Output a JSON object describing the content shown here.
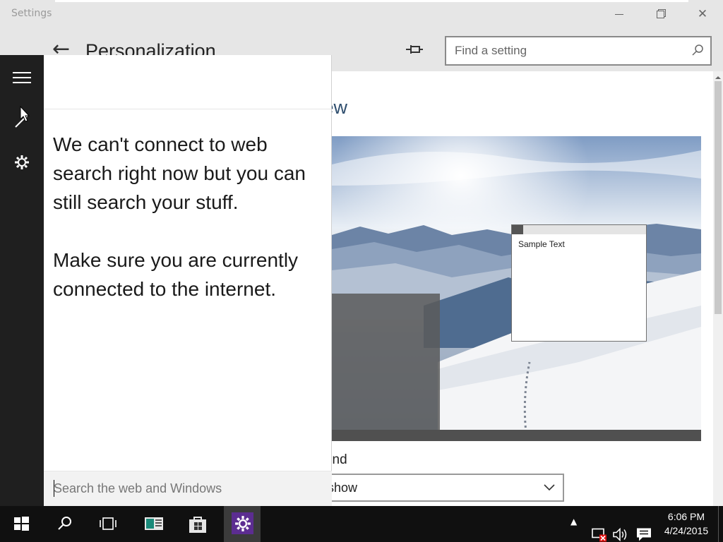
{
  "window": {
    "title": "Settings"
  },
  "header": {
    "page_title": "Personalization",
    "search_placeholder": "Find a setting"
  },
  "content": {
    "preview_title": "eview",
    "sample_text": "Sample Text",
    "background_label": "kground",
    "background_value": "ide show"
  },
  "cortana": {
    "message_line1": "We can't connect to web search right now but you can still search your stuff.",
    "message_line2": "Make sure you are currently connected to the internet.",
    "search_placeholder": "Search the web and Windows"
  },
  "taskbar": {
    "time": "6:06 PM",
    "date": "4/24/2015",
    "accent_color": "#5c2d91"
  },
  "icons": [
    "windows-logo-icon",
    "search-icon",
    "task-view-icon",
    "app-icon",
    "store-icon",
    "settings-icon",
    "chevron-up-icon",
    "network-icon",
    "volume-icon",
    "action-center-icon",
    "hamburger-icon",
    "pen-icon",
    "gear-icon",
    "pin-icon",
    "back-arrow-icon"
  ]
}
